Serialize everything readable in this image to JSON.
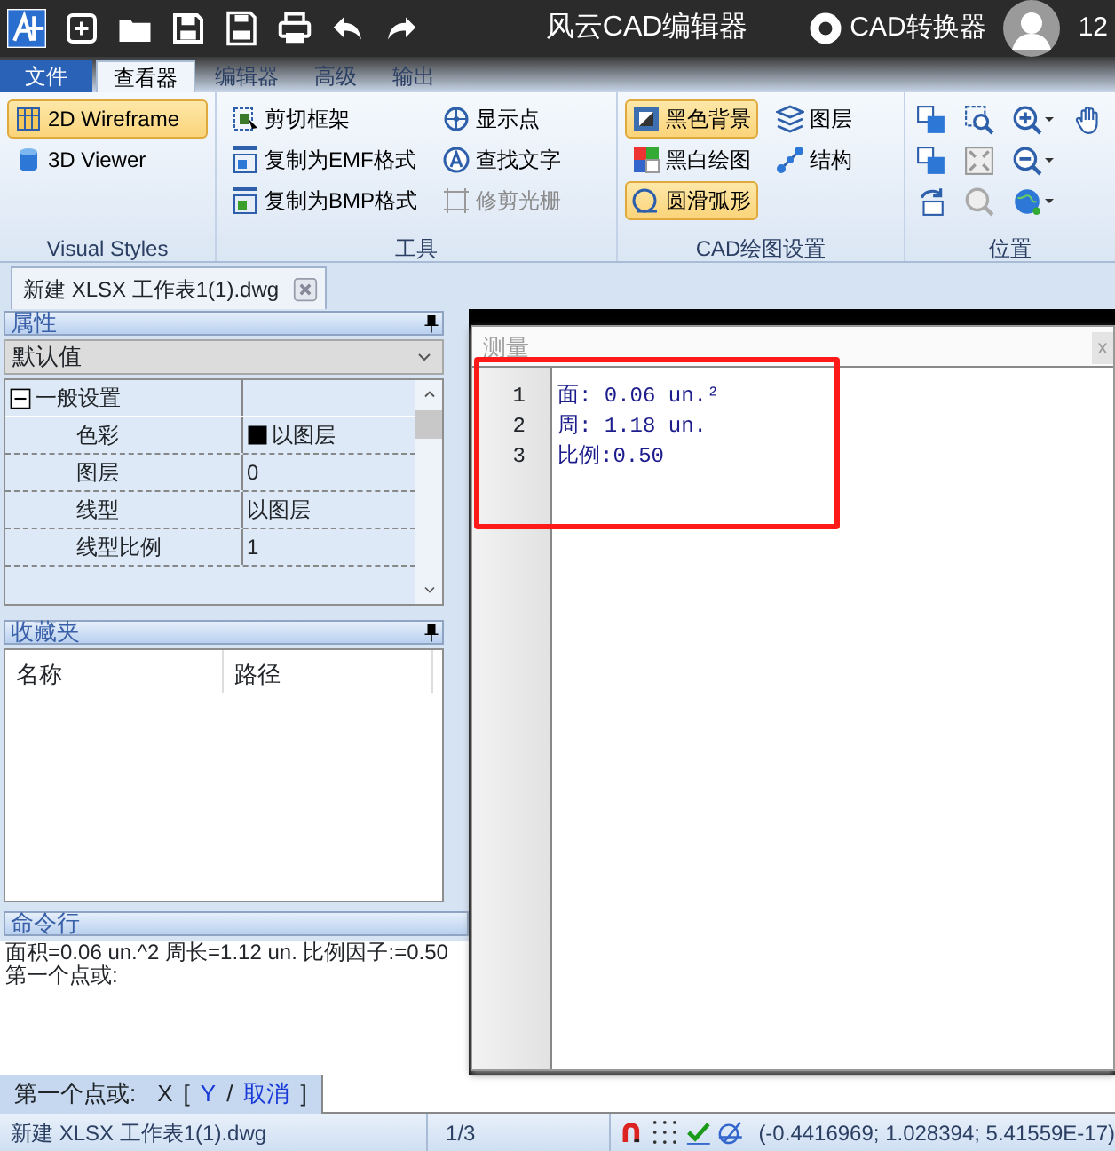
{
  "title_bar": {
    "title": "风云CAD编辑器",
    "converter_label": "CAD转换器",
    "user_label": "12"
  },
  "menu_tabs": [
    {
      "label": "文件",
      "kind": "file",
      "selected": false
    },
    {
      "label": "查看器",
      "kind": "tab",
      "selected": true
    },
    {
      "label": "编辑器",
      "kind": "tab",
      "selected": false
    },
    {
      "label": "高级",
      "kind": "tab",
      "selected": false
    },
    {
      "label": "输出",
      "kind": "tab",
      "selected": false
    }
  ],
  "ribbon": {
    "visual_styles": {
      "title": "Visual Styles",
      "buttons": [
        {
          "label": "2D Wireframe",
          "selected": true
        },
        {
          "label": "3D Viewer",
          "selected": false
        }
      ]
    },
    "tools": {
      "title": "工具",
      "buttons": [
        {
          "label": "剪切框架",
          "disabled": false
        },
        {
          "label": "复制为EMF格式",
          "disabled": false
        },
        {
          "label": "复制为BMP格式",
          "disabled": false
        },
        {
          "label": "显示点",
          "disabled": false
        },
        {
          "label": "查找文字",
          "disabled": false
        },
        {
          "label": "修剪光栅",
          "disabled": true
        }
      ]
    },
    "cad_settings": {
      "title": "CAD绘图设置",
      "buttons": [
        {
          "label": "黑色背景",
          "selected": true
        },
        {
          "label": "黑白绘图",
          "selected": false
        },
        {
          "label": "圆滑弧形",
          "selected": true
        },
        {
          "label": "图层",
          "selected": false
        },
        {
          "label": "结构",
          "selected": false
        }
      ]
    },
    "position": {
      "title": "位置"
    }
  },
  "doc_tabs": [
    {
      "label": "新建 XLSX 工作表1(1).dwg",
      "selected": true
    }
  ],
  "properties": {
    "title": "属性",
    "dropdown": "默认值",
    "section": {
      "label": "一般设置",
      "expanded": true
    },
    "rows": [
      {
        "name": "色彩",
        "value": "以图层",
        "kind": "color"
      },
      {
        "name": "图层",
        "value": "0",
        "kind": "text"
      },
      {
        "name": "线型",
        "value": "以图层",
        "kind": "text"
      },
      {
        "name": "线型比例",
        "value": "1",
        "kind": "text"
      }
    ]
  },
  "favorites": {
    "title": "收藏夹",
    "columns": [
      "名称",
      "路径"
    ]
  },
  "command_panel": {
    "title": "命令行",
    "lines": [
      "面积=0.06 un.^2 周长=1.12 un. 比例因子:=0.50",
      "第一个点或:"
    ]
  },
  "command_prompt": {
    "parts": [
      {
        "text": "第一个点或:",
        "kind": "text"
      },
      {
        "text": "X",
        "kind": "text"
      },
      {
        "text": "[",
        "kind": "text"
      },
      {
        "text": "Y",
        "kind": "link"
      },
      {
        "text": "/",
        "kind": "text"
      },
      {
        "text": "取消",
        "kind": "link"
      },
      {
        "text": "]",
        "kind": "text"
      }
    ]
  },
  "measure_dialog": {
    "title": "测量",
    "close": "x",
    "highlighted": true,
    "lines": [
      {
        "number": "1",
        "text": "面: 0.06 un.²"
      },
      {
        "number": "2",
        "text": "周: 1.18 un."
      },
      {
        "number": "3",
        "text": "比例:0.50"
      }
    ]
  },
  "status_bar": {
    "file": "新建 XLSX 工作表1(1).dwg",
    "page": "1/3",
    "coordinates": "(-0.4416969; 1.028394; 5.41559E-17)"
  }
}
